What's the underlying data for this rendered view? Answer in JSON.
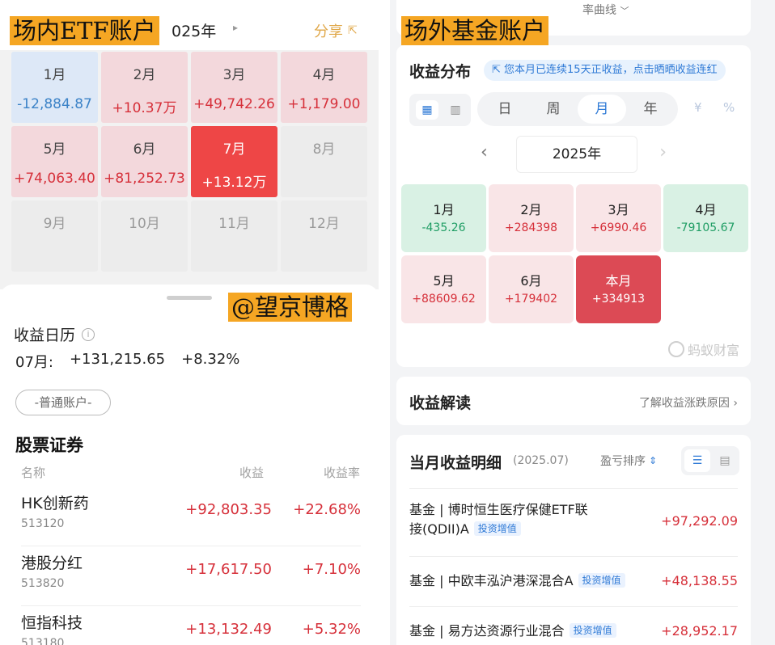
{
  "left": {
    "overlay_label": "场内ETF账户",
    "year_label": "025年",
    "share_label": "分享",
    "months": [
      {
        "month": "1月",
        "value": "-12,884.87",
        "style": "blue"
      },
      {
        "month": "2月",
        "value": "+10.37万",
        "style": "pink"
      },
      {
        "month": "3月",
        "value": "+49,742.26",
        "style": "pink"
      },
      {
        "month": "4月",
        "value": "+1,179.00",
        "style": "pink"
      },
      {
        "month": "5月",
        "value": "+74,063.40",
        "style": "pink"
      },
      {
        "month": "6月",
        "value": "+81,252.73",
        "style": "pink"
      },
      {
        "month": "7月",
        "value": "+13.12万",
        "style": "red"
      },
      {
        "month": "8月",
        "value": "",
        "style": "empty"
      },
      {
        "month": "9月",
        "value": "",
        "style": "empty"
      },
      {
        "month": "10月",
        "value": "",
        "style": "empty"
      },
      {
        "month": "11月",
        "value": "",
        "style": "empty"
      },
      {
        "month": "12月",
        "value": "",
        "style": "empty"
      }
    ],
    "watermark_label": "@望京博格",
    "calendar_title": "收益日历",
    "summary_month": "07月:",
    "summary_amount": "+131,215.65",
    "summary_rate": "+8.32%",
    "account_chip": "-普通账户-",
    "section_title": "股票证券",
    "col_name": "名称",
    "col_gain": "收益",
    "col_rate": "收益率",
    "stocks": [
      {
        "name": "HK创新药",
        "code": "513120",
        "gain": "+92,803.35",
        "rate": "+22.68%"
      },
      {
        "name": "港股分红",
        "code": "513820",
        "gain": "+17,617.50",
        "rate": "+7.10%"
      },
      {
        "name": "恒指科技",
        "code": "513180",
        "gain": "+13,132.49",
        "rate": "+5.32%"
      }
    ]
  },
  "right": {
    "overlay_label": "场外基金账户",
    "rate_curve_label": "率曲线",
    "dist_title": "收益分布",
    "streak_text": "您本月已连续15天正收益，点击晒晒收益连红",
    "periods": [
      "日",
      "周",
      "月",
      "年"
    ],
    "active_period": "月",
    "unit_yuan": "¥",
    "unit_pct": "%",
    "year_label": "2025年",
    "months": [
      {
        "month": "1月",
        "value": "-435.26",
        "style": "green"
      },
      {
        "month": "2月",
        "value": "+284398",
        "style": "pink"
      },
      {
        "month": "3月",
        "value": "+6990.46",
        "style": "pink"
      },
      {
        "month": "4月",
        "value": "-79105.67",
        "style": "green"
      },
      {
        "month": "5月",
        "value": "+88609.62",
        "style": "pink"
      },
      {
        "month": "6月",
        "value": "+179402",
        "style": "pink"
      },
      {
        "month": "本月",
        "value": "+334913",
        "style": "red"
      }
    ],
    "brand_watermark": "蚂蚁财富",
    "interp_title": "收益解读",
    "interp_link": "了解收益涨跌原因",
    "detail_title": "当月收益明细",
    "detail_date": "(2025.07)",
    "sort_label": "盈亏排序",
    "funds": [
      {
        "name_line1": "基金 | 博时恒生医疗保健ETF联",
        "name_line2": "接(QDII)A",
        "tag": "投资增值",
        "amount": "+97,292.09"
      },
      {
        "name_line1": "基金 | 中欧丰泓沪港深混合A",
        "name_line2": "",
        "tag": "投资增值",
        "amount": "+48,138.55"
      },
      {
        "name_line1": "基金 | 易方达资源行业混合",
        "name_line2": "",
        "tag": "投资增值",
        "amount": "+28,952.17"
      }
    ]
  },
  "colors": {
    "gain_red": "#d6303a",
    "loss_blue": "#3b82c7",
    "loss_green": "#1f9d64",
    "accent_blue": "#2f7ad6",
    "overlay_orange": "#f5a623"
  }
}
